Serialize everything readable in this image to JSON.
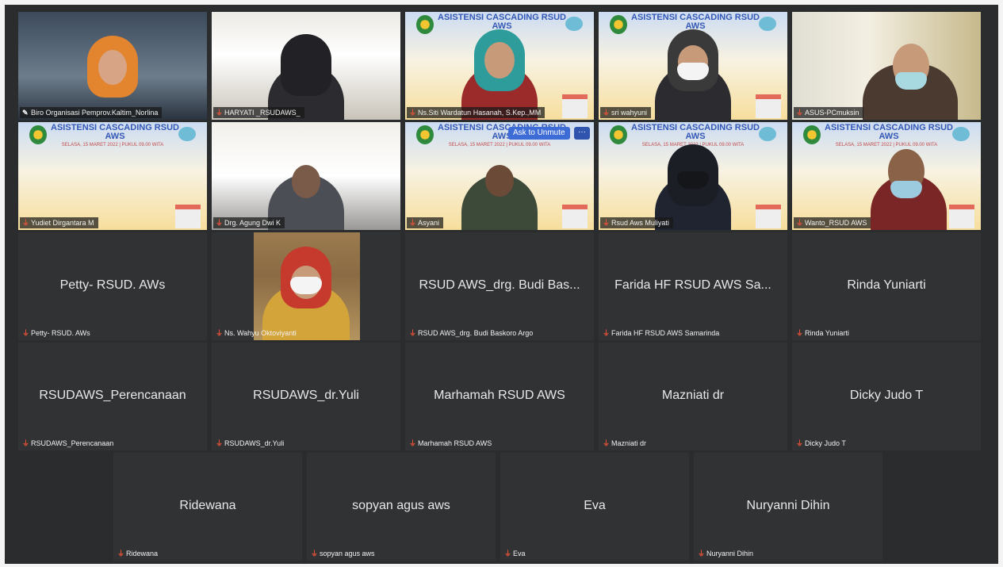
{
  "banner": {
    "title": "ASISTENSI CASCADING RSUD AWS",
    "subtitle": "SELASA, 15 MARET 2022 | PUKUL 09.00 WITA"
  },
  "video_tiles": [
    {
      "name": "Biro Organisasi Pemprov.Kaltim_Norlina",
      "muted": false,
      "active": true
    },
    {
      "name": "HARYATI _RSUDAWS_",
      "muted": true
    },
    {
      "name": "Ns.Siti Wardatun Hasanah, S.Kep.,MM",
      "muted": true
    },
    {
      "name": "sri wahyuni",
      "muted": true
    },
    {
      "name": "ASUS-PCmuksin",
      "muted": true
    },
    {
      "name": "Yudiet Dirgantara M",
      "muted": true
    },
    {
      "name": "Drg. Agung Dwi K",
      "muted": true
    },
    {
      "name": "Asyani",
      "muted": true
    },
    {
      "name": "Rsud Aws Muliyati",
      "muted": true
    },
    {
      "name": "Wanto_RSUD AWS",
      "muted": true
    }
  ],
  "controls": {
    "ask_to_unmute": "Ask to Unmute",
    "more": "···"
  },
  "name_tiles": [
    {
      "display": "Petty- RSUD. AWs",
      "label": "Petty- RSUD. AWs"
    },
    {
      "display": "",
      "label": "Ns. Wahyu Oktoviyanti"
    },
    {
      "display": "RSUD AWS_drg. Budi Bas...",
      "label": "RSUD AWS_drg. Budi Baskoro Argo"
    },
    {
      "display": "Farida HF RSUD AWS Sa...",
      "label": "Farida HF RSUD AWS Samarinda"
    },
    {
      "display": "Rinda Yuniarti",
      "label": "Rinda Yuniarti"
    },
    {
      "display": "RSUDAWS_Perencanaan",
      "label": "RSUDAWS_Perencanaan"
    },
    {
      "display": "RSUDAWS_dr.Yuli",
      "label": "RSUDAWS_dr.Yuli"
    },
    {
      "display": "Marhamah RSUD AWS",
      "label": "Marhamah RSUD AWS"
    },
    {
      "display": "Mazniati dr",
      "label": "Mazniati dr"
    },
    {
      "display": "Dicky Judo T",
      "label": "Dicky Judo T"
    },
    {
      "display": "Ridewana",
      "label": "Ridewana"
    },
    {
      "display": "sopyan agus aws",
      "label": "sopyan agus aws"
    },
    {
      "display": "Eva",
      "label": "Eva"
    },
    {
      "display": "Nuryanni Dihin",
      "label": "Nuryanni Dihin"
    }
  ],
  "icons": {
    "mic_muted": "mic-muted-icon",
    "mic_on": "mic-icon"
  },
  "colors": {
    "active_speaker_border": "#8cd36b",
    "mute_icon": "#e4523b",
    "unmute_button": "#3e6cd6"
  }
}
